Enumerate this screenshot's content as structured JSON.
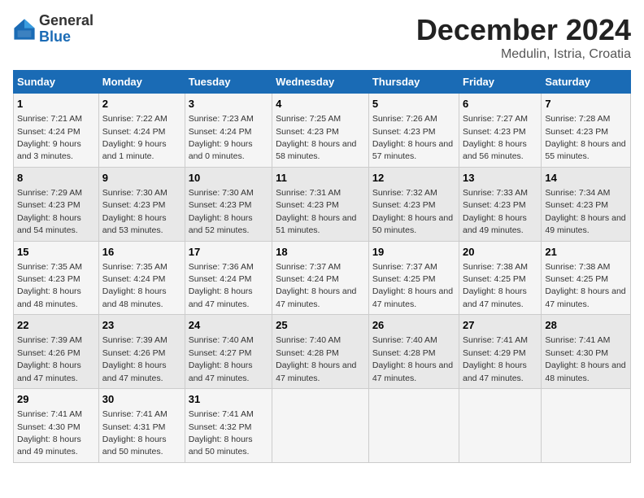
{
  "header": {
    "logo_line1": "General",
    "logo_line2": "Blue",
    "title": "December 2024",
    "subtitle": "Medulin, Istria, Croatia"
  },
  "weekdays": [
    "Sunday",
    "Monday",
    "Tuesday",
    "Wednesday",
    "Thursday",
    "Friday",
    "Saturday"
  ],
  "weeks": [
    [
      {
        "day": "1",
        "sunrise": "7:21 AM",
        "sunset": "4:24 PM",
        "daylight": "9 hours and 3 minutes."
      },
      {
        "day": "2",
        "sunrise": "7:22 AM",
        "sunset": "4:24 PM",
        "daylight": "9 hours and 1 minute."
      },
      {
        "day": "3",
        "sunrise": "7:23 AM",
        "sunset": "4:24 PM",
        "daylight": "9 hours and 0 minutes."
      },
      {
        "day": "4",
        "sunrise": "7:25 AM",
        "sunset": "4:23 PM",
        "daylight": "8 hours and 58 minutes."
      },
      {
        "day": "5",
        "sunrise": "7:26 AM",
        "sunset": "4:23 PM",
        "daylight": "8 hours and 57 minutes."
      },
      {
        "day": "6",
        "sunrise": "7:27 AM",
        "sunset": "4:23 PM",
        "daylight": "8 hours and 56 minutes."
      },
      {
        "day": "7",
        "sunrise": "7:28 AM",
        "sunset": "4:23 PM",
        "daylight": "8 hours and 55 minutes."
      }
    ],
    [
      {
        "day": "8",
        "sunrise": "7:29 AM",
        "sunset": "4:23 PM",
        "daylight": "8 hours and 54 minutes."
      },
      {
        "day": "9",
        "sunrise": "7:30 AM",
        "sunset": "4:23 PM",
        "daylight": "8 hours and 53 minutes."
      },
      {
        "day": "10",
        "sunrise": "7:30 AM",
        "sunset": "4:23 PM",
        "daylight": "8 hours and 52 minutes."
      },
      {
        "day": "11",
        "sunrise": "7:31 AM",
        "sunset": "4:23 PM",
        "daylight": "8 hours and 51 minutes."
      },
      {
        "day": "12",
        "sunrise": "7:32 AM",
        "sunset": "4:23 PM",
        "daylight": "8 hours and 50 minutes."
      },
      {
        "day": "13",
        "sunrise": "7:33 AM",
        "sunset": "4:23 PM",
        "daylight": "8 hours and 49 minutes."
      },
      {
        "day": "14",
        "sunrise": "7:34 AM",
        "sunset": "4:23 PM",
        "daylight": "8 hours and 49 minutes."
      }
    ],
    [
      {
        "day": "15",
        "sunrise": "7:35 AM",
        "sunset": "4:23 PM",
        "daylight": "8 hours and 48 minutes."
      },
      {
        "day": "16",
        "sunrise": "7:35 AM",
        "sunset": "4:24 PM",
        "daylight": "8 hours and 48 minutes."
      },
      {
        "day": "17",
        "sunrise": "7:36 AM",
        "sunset": "4:24 PM",
        "daylight": "8 hours and 47 minutes."
      },
      {
        "day": "18",
        "sunrise": "7:37 AM",
        "sunset": "4:24 PM",
        "daylight": "8 hours and 47 minutes."
      },
      {
        "day": "19",
        "sunrise": "7:37 AM",
        "sunset": "4:25 PM",
        "daylight": "8 hours and 47 minutes."
      },
      {
        "day": "20",
        "sunrise": "7:38 AM",
        "sunset": "4:25 PM",
        "daylight": "8 hours and 47 minutes."
      },
      {
        "day": "21",
        "sunrise": "7:38 AM",
        "sunset": "4:25 PM",
        "daylight": "8 hours and 47 minutes."
      }
    ],
    [
      {
        "day": "22",
        "sunrise": "7:39 AM",
        "sunset": "4:26 PM",
        "daylight": "8 hours and 47 minutes."
      },
      {
        "day": "23",
        "sunrise": "7:39 AM",
        "sunset": "4:26 PM",
        "daylight": "8 hours and 47 minutes."
      },
      {
        "day": "24",
        "sunrise": "7:40 AM",
        "sunset": "4:27 PM",
        "daylight": "8 hours and 47 minutes."
      },
      {
        "day": "25",
        "sunrise": "7:40 AM",
        "sunset": "4:28 PM",
        "daylight": "8 hours and 47 minutes."
      },
      {
        "day": "26",
        "sunrise": "7:40 AM",
        "sunset": "4:28 PM",
        "daylight": "8 hours and 47 minutes."
      },
      {
        "day": "27",
        "sunrise": "7:41 AM",
        "sunset": "4:29 PM",
        "daylight": "8 hours and 47 minutes."
      },
      {
        "day": "28",
        "sunrise": "7:41 AM",
        "sunset": "4:30 PM",
        "daylight": "8 hours and 48 minutes."
      }
    ],
    [
      {
        "day": "29",
        "sunrise": "7:41 AM",
        "sunset": "4:30 PM",
        "daylight": "8 hours and 49 minutes."
      },
      {
        "day": "30",
        "sunrise": "7:41 AM",
        "sunset": "4:31 PM",
        "daylight": "8 hours and 50 minutes."
      },
      {
        "day": "31",
        "sunrise": "7:41 AM",
        "sunset": "4:32 PM",
        "daylight": "8 hours and 50 minutes."
      },
      null,
      null,
      null,
      null
    ]
  ]
}
